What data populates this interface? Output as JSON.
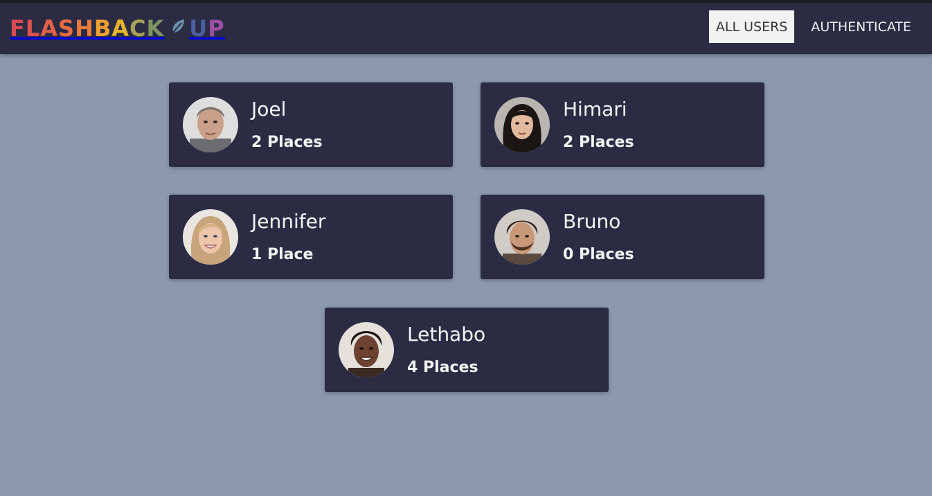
{
  "header": {
    "logo_letters": [
      {
        "char": "F",
        "color": "#d94b52"
      },
      {
        "char": "L",
        "color": "#de5350"
      },
      {
        "char": "A",
        "color": "#e2604a"
      },
      {
        "char": "S",
        "color": "#e66b44"
      },
      {
        "char": "H",
        "color": "#eb7a3c"
      },
      {
        "char": "B",
        "color": "#f0a030"
      },
      {
        "char": "A",
        "color": "#e8b32c"
      },
      {
        "char": "C",
        "color": "#a5a257"
      },
      {
        "char": "K",
        "color": "#7d9460"
      },
      {
        "char": "U",
        "color": "#4b5fa0"
      },
      {
        "char": "P",
        "color": "#9d4ea5"
      }
    ],
    "logo_icon": "feather-icon",
    "logo_icon_color": "#6a8fa6",
    "nav": [
      {
        "label": "ALL USERS",
        "active": true
      },
      {
        "label": "AUTHENTICATE",
        "active": false
      }
    ]
  },
  "users": [
    {
      "name": "Joel",
      "places": "2 Places",
      "avatar": "avatar-man-grey-hair"
    },
    {
      "name": "Himari",
      "places": "2 Places",
      "avatar": "avatar-woman-dark-hair"
    },
    {
      "name": "Jennifer",
      "places": "1 Place",
      "avatar": "avatar-woman-blonde-hair"
    },
    {
      "name": "Bruno",
      "places": "0 Places",
      "avatar": "avatar-man-curly-beard"
    },
    {
      "name": "Lethabo",
      "places": "4 Places",
      "avatar": "avatar-man-curly-dark"
    }
  ],
  "colors": {
    "background": "#8b98b0",
    "header": "#2b2c44",
    "card": "#2b2c44",
    "text": "#f4f4f4",
    "active_nav_bg": "#f2f2f2"
  }
}
